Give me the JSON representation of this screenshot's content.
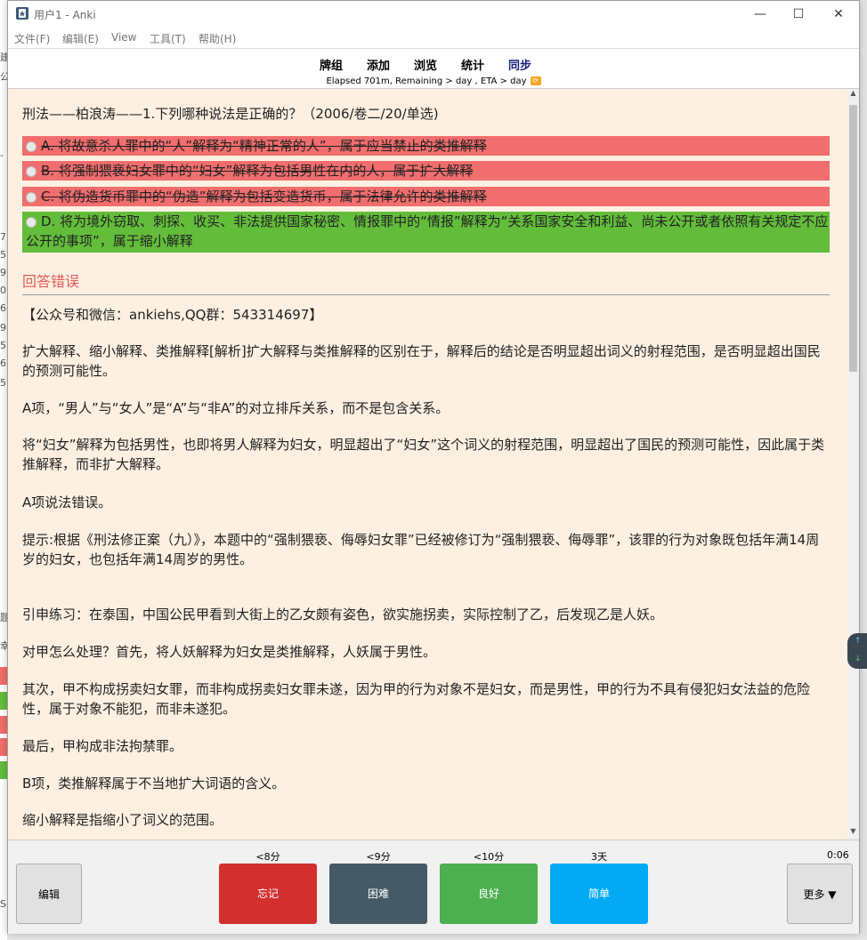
{
  "window": {
    "title": "用户1 - Anki",
    "minimize": "—",
    "maximize": "☐",
    "close": "✕"
  },
  "menu": [
    "文件(F)",
    "编辑(E)",
    "View",
    "工具(T)",
    "帮助(H)"
  ],
  "toolbar": {
    "decks": "牌组",
    "add": "添加",
    "browse": "浏览",
    "stats": "统计",
    "sync": "同步"
  },
  "status": "Elapsed 701m, Remaining > day , ETA > day",
  "question": {
    "title": "刑法——柏浪涛——1.下列哪种说法是正确的？（2006/卷二/20/单选)",
    "options": [
      {
        "text": "A. 将故意杀人罪中的“人”解释为“精神正常的人”，属于应当禁止的类推解释",
        "state": "wrong"
      },
      {
        "text": "B. 将强制猥亵妇女罪中的“妇女”解释为包括男性在内的人，属于扩大解释",
        "state": "wrong"
      },
      {
        "text": "C. 将伪造货币罪中的“伪造”解释为包括变造货币，属于法律允许的类推解释",
        "state": "wrong"
      },
      {
        "text": "D. 将为境外窃取、刺探、收买、非法提供国家秘密、情报罪中的“情报”解释为“关系国家安全和利益、尚未公开或者依照有关规定不应公开的事项”，属于缩小解释",
        "state": "right"
      }
    ]
  },
  "result": "回答错误",
  "explanation": [
    "【公众号和微信：ankiehs,QQ群：543314697】",
    "扩大解释、缩小解释、类推解释[解析]扩大解释与类推解释的区别在于，解释后的结论是否明显超出词义的射程范围，是否明显超出国民的预测可能性。",
    "A项，“男人”与“女人”是“A”与“非A”的对立排斥关系，而不是包含关系。",
    "将“妇女”解释为包括男性，也即将男人解释为妇女，明显超出了“妇女”这个词义的射程范围，明显超出了国民的预测可能性，因此属于类推解释，而非扩大解释。",
    "A项说法错误。",
    "提示:根据《刑法修正案（九）》，本题中的“强制猥亵、侮辱妇女罪”已经被修订为“强制猥亵、侮辱罪”，该罪的行为对象既包括年满14周岁的妇女，也包括年满14周岁的男性。",
    "引申练习：在泰国，中国公民甲看到大街上的乙女颇有姿色，欲实施拐卖，实际控制了乙，后发现乙是人妖。",
    "对甲怎么处理？首先，将人妖解释为妇女是类推解释，人妖属于男性。",
    "其次，甲不构成拐卖妇女罪，而非构成拐卖妇女罪未遂，因为甲的行为对象不是妇女，而是男性，甲的行为不具有侵犯妇女法益的危险性，属于对象不能犯，而非未遂犯。",
    "最后，甲构成非法拘禁罪。",
    "B项，类推解释属于不当地扩大词语的含义。",
    "缩小解释是指缩小了词义的范围。"
  ],
  "bottom": {
    "edit": "编辑",
    "more": "更多 ▼",
    "timer": "0:06",
    "answers": [
      {
        "label": "忘记",
        "time": "<8分",
        "color": "#d32f2f"
      },
      {
        "label": "困难",
        "time": "<9分",
        "color": "#455a64"
      },
      {
        "label": "良好",
        "time": "<10分",
        "color": "#4caf50"
      },
      {
        "label": "简单",
        "time": "3天",
        "color": "#03a9f4"
      }
    ]
  },
  "background_window_chars": [
    "建",
    "公",
    "-",
    "7",
    "5",
    "9",
    "0",
    "6",
    "9",
    "5",
    "6",
    "5",
    "题",
    "幸",
    "S"
  ]
}
